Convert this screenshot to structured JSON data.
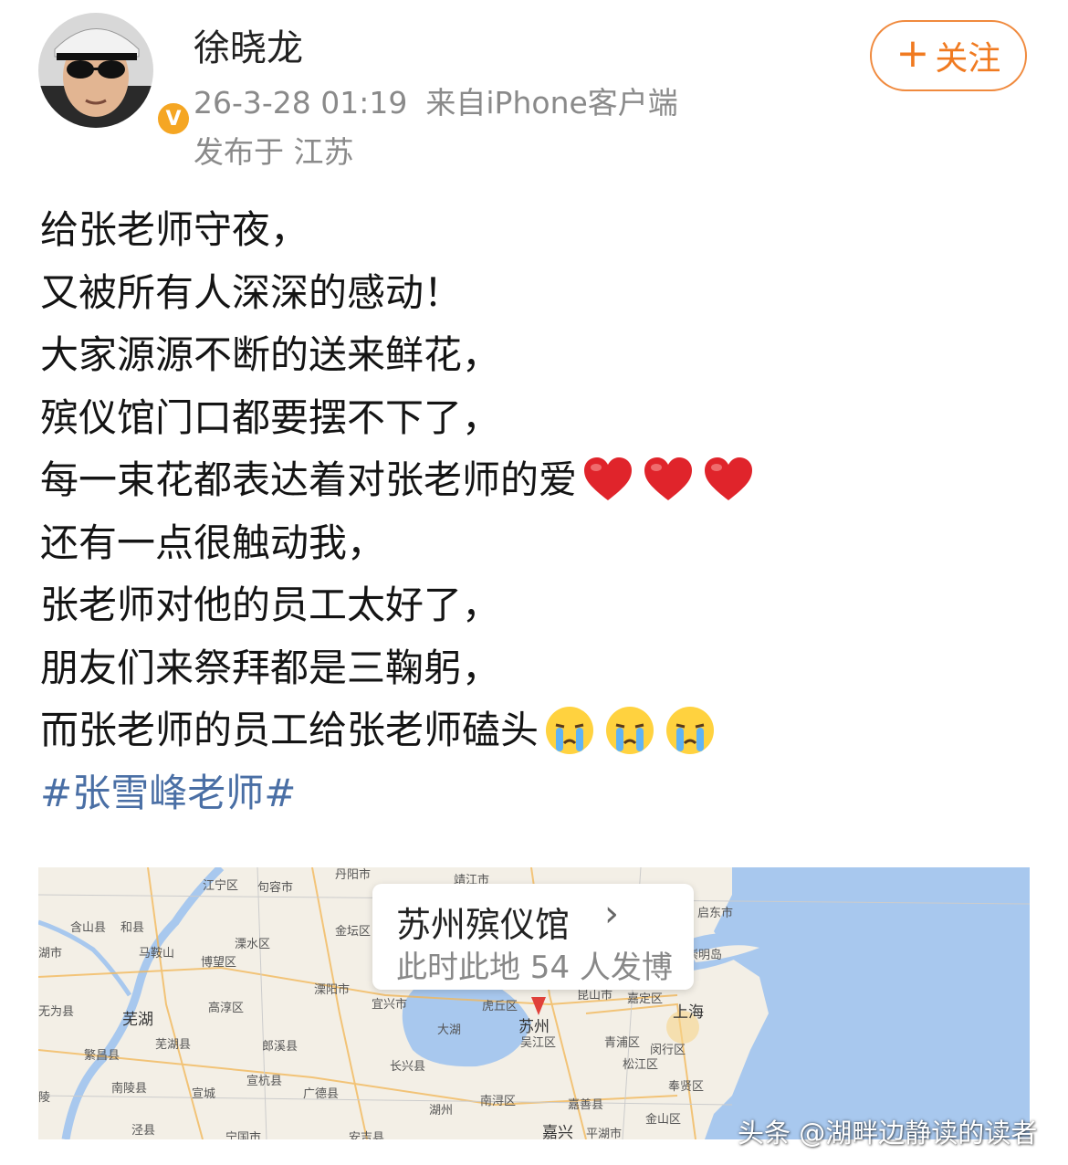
{
  "header": {
    "username": "徐晓龙",
    "time": "26-3-28 01:19",
    "source": "来自iPhone客户端",
    "location": "发布于 江苏",
    "follow_label": "关注",
    "follow_icon": "plus-icon"
  },
  "post": {
    "lines": [
      "给张老师守夜，",
      "又被所有人深深的感动！",
      "大家源源不断的送来鲜花，",
      "殡仪馆门口都要摆不下了，",
      "每一束花都表达着对张老师的爱",
      "还有一点很触动我，",
      "张老师对他的员工太好了，",
      "朋友们来祭拜都是三鞠躬，",
      "而张老师的员工给张老师磕头"
    ],
    "hashtag": "#张雪峰老师#",
    "line5_emoji": "heart-emoji",
    "line9_emoji": "crying-face-emoji"
  },
  "map": {
    "place_name": "苏州殡仪馆",
    "stat": "此时此地 54 人发博",
    "labels": [
      "丹阳市",
      "靖江市",
      "江宁区",
      "句容市",
      "含山县",
      "和县",
      "金坛区",
      "启东市",
      "马鞍山",
      "溧水区",
      "博望区",
      "海门",
      "崇明岛",
      "湖市",
      "溧阳市",
      "宜兴市",
      "虎丘区",
      "昆山市",
      "嘉定区",
      "无为县",
      "芜湖",
      "高淳区",
      "大湖",
      "苏州",
      "上海",
      "吴江区",
      "青浦区",
      "闵行区",
      "繁昌县",
      "芜湖县",
      "郎溪县",
      "长兴县",
      "松江区",
      "南陵县",
      "宣城",
      "宣杭县",
      "广德县",
      "南浔区",
      "奉贤区",
      "湖州",
      "嘉善县",
      "金山区",
      "泾县",
      "宁国市",
      "安吉县",
      "嘉兴",
      "平湖市",
      "陵"
    ],
    "water_color": "#a8c8ee",
    "land_color": "#f3efe6"
  },
  "watermark": "头条 @湖畔边静读的读者"
}
